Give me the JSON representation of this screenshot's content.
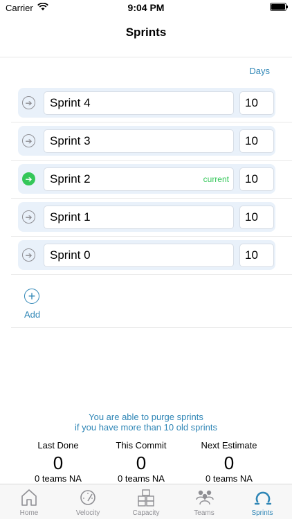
{
  "status_bar": {
    "carrier": "Carrier",
    "time": "9:04 PM"
  },
  "nav": {
    "title": "Sprints"
  },
  "list": {
    "days_header": "Days",
    "sprints": [
      {
        "name": "Sprint 4",
        "days": "10",
        "tag": "",
        "current": false
      },
      {
        "name": "Sprint 3",
        "days": "10",
        "tag": "",
        "current": false
      },
      {
        "name": "Sprint 2",
        "days": "10",
        "tag": "current",
        "current": true
      },
      {
        "name": "Sprint 1",
        "days": "10",
        "tag": "",
        "current": false
      },
      {
        "name": "Sprint 0",
        "days": "10",
        "tag": "",
        "current": false
      }
    ]
  },
  "add": {
    "label": "Add"
  },
  "purge_note": {
    "line1": "You are able to purge sprints",
    "line2": "if you have more than 10 old sprints"
  },
  "stats": [
    {
      "label": "Last Done",
      "value": "0",
      "sub": "0 teams NA"
    },
    {
      "label": "This Commit",
      "value": "0",
      "sub": "0 teams NA"
    },
    {
      "label": "Next Estimate",
      "value": "0",
      "sub": "0 teams NA"
    }
  ],
  "tabbar": {
    "tabs": [
      {
        "label": "Home",
        "icon": "home-icon",
        "active": false
      },
      {
        "label": "Velocity",
        "icon": "speedometer-icon",
        "active": false
      },
      {
        "label": "Capacity",
        "icon": "boxes-icon",
        "active": false
      },
      {
        "label": "Teams",
        "icon": "people-icon",
        "active": false
      },
      {
        "label": "Sprints",
        "icon": "cycle-icon",
        "active": true
      }
    ]
  },
  "colors": {
    "accent": "#2f86b6",
    "current": "#34c759",
    "card": "#e9f1fa"
  }
}
